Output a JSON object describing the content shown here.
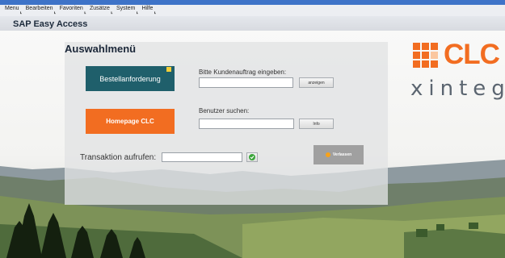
{
  "menubar": {
    "items": [
      "Menu",
      "Bearbeiten",
      "Favoriten",
      "Zusätze",
      "System",
      "Hilfe"
    ]
  },
  "app": {
    "title": "SAP Easy Access"
  },
  "panel": {
    "title": "Auswahlmenü",
    "bestell_button": "Bestellanforderung",
    "homepage_button": "Homepage CLC",
    "kunden_label": "Bitte Kundenauftrag eingeben:",
    "kunden_value": "",
    "anzeigen_button": "anzeigen",
    "benutzer_label": "Benutzer suchen:",
    "benutzer_value": "",
    "info_button": "Info",
    "transaktion_label": "Transaktion aufrufen:",
    "transaktion_value": "",
    "verlassen_button": "Verlassen"
  },
  "logo": {
    "brand": "CLC",
    "sub": "xinteg"
  },
  "colors": {
    "accent_blue": "#3e73c8",
    "bestell_teal": "#1f5f6b",
    "homepage_orange": "#f26d21",
    "ok_green": "#3aa53a",
    "verlassen_gray": "#a0a0a0"
  },
  "icons": {
    "note": "note-icon",
    "ok": "check-icon",
    "verlassen": "warning-icon"
  }
}
